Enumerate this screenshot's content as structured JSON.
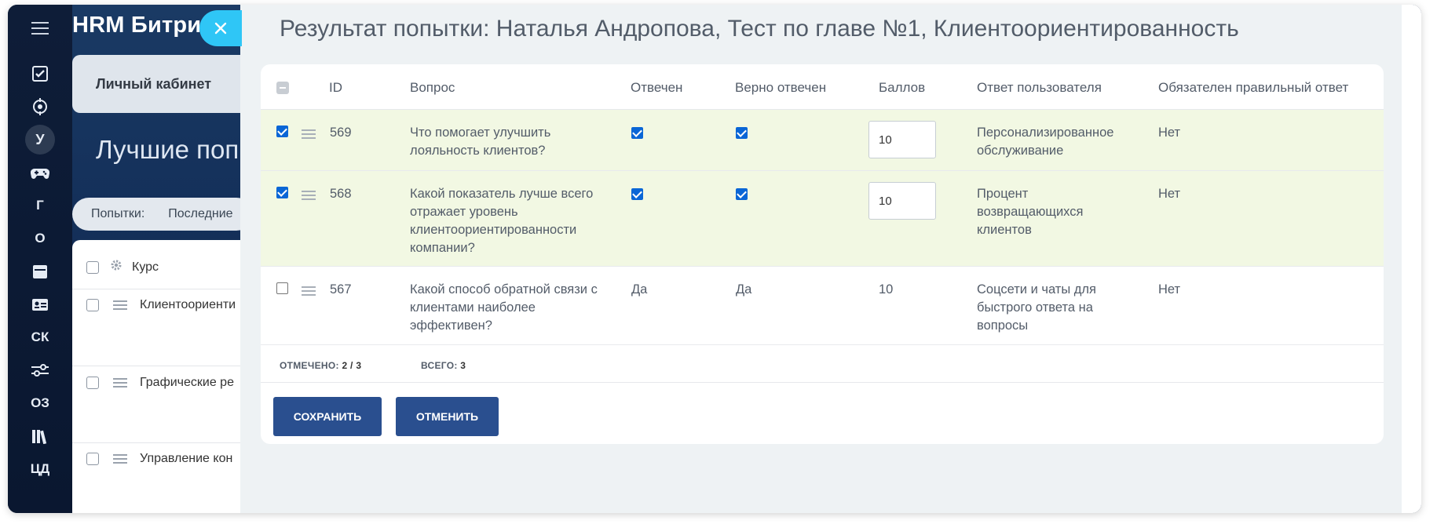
{
  "background": {
    "logo": "HRM Битри",
    "cabinet_label": "Личный кабинет",
    "page_title": "Лучшие попы",
    "filter": {
      "label": "Попытки:",
      "value": "Последние"
    },
    "table_header": "Курс",
    "rows": [
      "Клиентоориенти",
      "Графические ре",
      "Управление кон"
    ]
  },
  "rail": {
    "items": [
      {
        "icon": "menu-icon"
      },
      {
        "icon": "task-check-icon"
      },
      {
        "icon": "target-icon"
      },
      {
        "label": "У"
      },
      {
        "icon": "gamepad-icon"
      },
      {
        "label": "Г"
      },
      {
        "label": "О"
      },
      {
        "icon": "calendar-icon"
      },
      {
        "icon": "id-card-icon"
      },
      {
        "label": "СК"
      },
      {
        "icon": "sliders-icon"
      },
      {
        "label": "ОЗ"
      },
      {
        "icon": "library-icon"
      },
      {
        "label": "ЦД"
      }
    ]
  },
  "slider": {
    "title": "Результат попытки: Наталья Андропова, Тест по главе №1, Клиентоориентированность",
    "columns": {
      "id": "ID",
      "question": "Вопрос",
      "answered": "Отвечен",
      "correct": "Верно отвечен",
      "score": "Баллов",
      "user_answer": "Ответ пользователя",
      "required": "Обязателен правильный ответ"
    },
    "rows": [
      {
        "selected": true,
        "id": "569",
        "question": "Что помогает улучшить лояльность клиентов?",
        "answered_checked": true,
        "correct_checked": true,
        "score": "10",
        "user_answer": "Персонализированное обслуживание",
        "required": "Нет"
      },
      {
        "selected": true,
        "id": "568",
        "question": "Какой показатель лучше всего отражает уровень клиентоориентированности компании?",
        "answered_checked": true,
        "correct_checked": true,
        "score": "10",
        "user_answer": "Процент возвращающихся клиентов",
        "required": "Нет"
      },
      {
        "selected": false,
        "id": "567",
        "question": "Какой способ обратной связи с клиентами наиболее эффективен?",
        "answered_text": "Да",
        "correct_text": "Да",
        "score": "10",
        "user_answer": "Соцсети и чаты для быстрого ответа на вопросы",
        "required": "Нет"
      }
    ],
    "footer": {
      "marked_label": "ОТМЕЧЕНО:",
      "marked_value": "2 / 3",
      "total_label": "ВСЕГО:",
      "total_value": "3"
    },
    "buttons": {
      "save": "СОХРАНИТЬ",
      "cancel": "ОТМЕНИТЬ"
    }
  },
  "colors": {
    "accent": "#2fc6f6",
    "button": "#2a4f8f",
    "selected_row": "#f2f8e3",
    "checkbox": "#0a66d6"
  }
}
